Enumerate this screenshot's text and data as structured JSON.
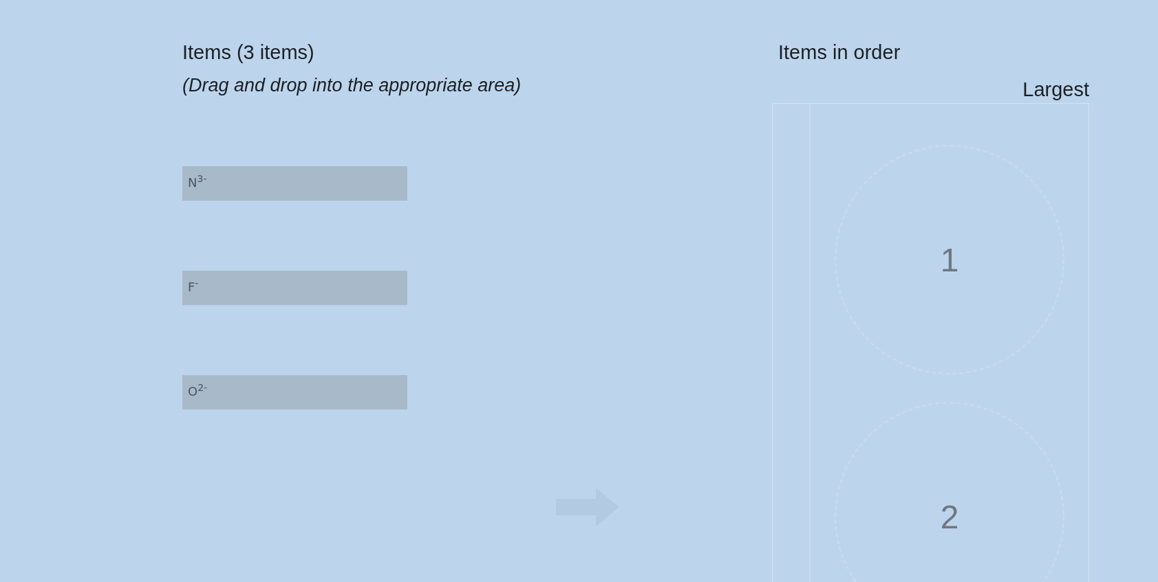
{
  "items_panel": {
    "title": "Items (3 items)",
    "instruction": "(Drag and drop into the appropriate area)",
    "items": [
      {
        "label": "N$^{3-}$"
      },
      {
        "label": "F$^{-}$"
      },
      {
        "label": "O$^{2-}$"
      }
    ]
  },
  "order_panel": {
    "title": "Items in order",
    "end_label": "Largest",
    "slots": [
      {
        "number": "1"
      },
      {
        "number": "2"
      }
    ]
  }
}
